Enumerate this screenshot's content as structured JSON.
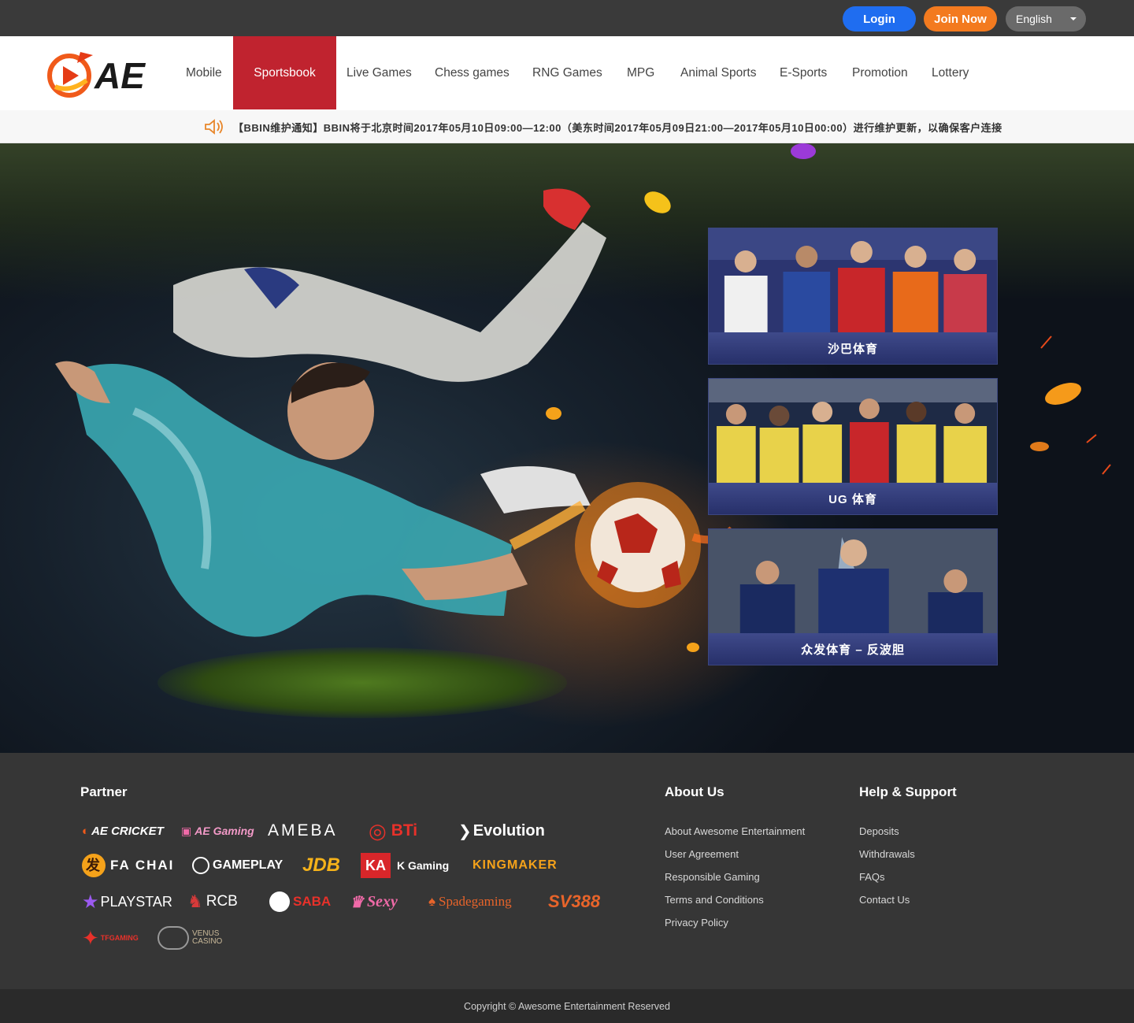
{
  "topbar": {
    "login_label": "Login",
    "join_label": "Join Now",
    "language": "English"
  },
  "nav": {
    "logo_text": "AE",
    "items": [
      {
        "label": "Mobile"
      },
      {
        "label": "Sportsbook",
        "active": true
      },
      {
        "label": "Live Games"
      },
      {
        "label": "Chess games"
      },
      {
        "label": "RNG Games"
      },
      {
        "label": "MPG"
      },
      {
        "label": "Animal Sports"
      },
      {
        "label": "E-Sports"
      },
      {
        "label": "Promotion"
      },
      {
        "label": "Lottery"
      }
    ]
  },
  "notice": {
    "icon": "speaker-icon",
    "text": "【BBIN维护通知】BBIN将于北京时间2017年05月10日09:00—12:00（美东时间2017年05月09日21:00—2017年05月10日00:00）进行维护更新，以确保客户连接"
  },
  "sports_cards": [
    {
      "label": "沙巴体育"
    },
    {
      "label": "UG 体育"
    },
    {
      "label": "众发体育 – 反波胆"
    }
  ],
  "footer": {
    "partner_heading": "Partner",
    "partners": [
      "AE CRICKET",
      "AE Gaming",
      "AMEBA",
      "BTi",
      "Evolution",
      "FA CHAI",
      "GAMEPLAY",
      "JDB",
      "KA",
      "K Gaming",
      "KINGMAKER",
      "PLAYSTAR",
      "RCB",
      "SABA",
      "Sexy",
      "Spadegaming",
      "SV388",
      "TFGAMING",
      "VENUS CASINO"
    ],
    "about_heading": "About Us",
    "about_links": [
      "About Awesome Entertainment",
      "User Agreement",
      "Responsible Gaming",
      "Terms and Conditions",
      "Privacy Policy"
    ],
    "help_heading": "Help & Support",
    "help_links": [
      "Deposits",
      "Withdrawals",
      "FAQs",
      "Contact Us"
    ],
    "copyright": "Copyright © Awesome Entertainment Reserved"
  },
  "colors": {
    "login": "#1f6df0",
    "join": "#f37a1f",
    "nav_active": "#c0232f",
    "footer_bg": "#363636"
  }
}
